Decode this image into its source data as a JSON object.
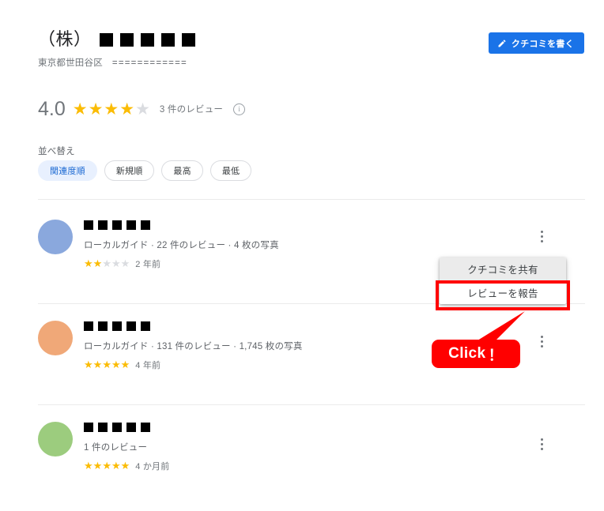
{
  "business": {
    "title_prefix": "（株）",
    "name_redacted_blocks": 5,
    "address": "東京都世田谷区",
    "address_masked": "============"
  },
  "write_review_button": {
    "label": "クチコミを書く",
    "icon": "pencil-icon",
    "color": "#1a73e8"
  },
  "rating_summary": {
    "value": "4.0",
    "stars_filled": 4,
    "stars_total": 5,
    "review_count_label": "3 件のレビュー",
    "info_icon": "info-icon",
    "star_color": "#fbbc04",
    "star_empty_color": "#dadce0"
  },
  "sort": {
    "label": "並べ替え",
    "chips": [
      {
        "label": "関連度順",
        "selected": true
      },
      {
        "label": "新規順",
        "selected": false
      },
      {
        "label": "最高",
        "selected": false
      },
      {
        "label": "最低",
        "selected": false
      }
    ],
    "selected_chip_bg": "#e8f0fe",
    "selected_chip_fg": "#1967d2"
  },
  "reviews": [
    {
      "avatar_color": "#8aa8dd",
      "name_redacted_blocks": 5,
      "meta": "ローカルガイド · 22 件のレビュー · 4 枚の写真",
      "stars_filled": 2,
      "stars_total": 5,
      "time": "2 年前"
    },
    {
      "avatar_color": "#f0a878",
      "name_redacted_blocks": 5,
      "meta": "ローカルガイド · 131 件のレビュー · 1,745 枚の写真",
      "stars_filled": 5,
      "stars_total": 5,
      "time": "4 年前"
    },
    {
      "avatar_color": "#9ccc7e",
      "name_redacted_blocks": 5,
      "meta": "1 件のレビュー",
      "stars_filled": 5,
      "stars_total": 5,
      "time": "4 か月前"
    }
  ],
  "context_menu": {
    "items": [
      {
        "label": "クチコミを共有",
        "highlighted": false
      },
      {
        "label": "レビューを報告",
        "highlighted": true
      }
    ],
    "hover_bg": "#ebebeb"
  },
  "annotation": {
    "label": "Click",
    "suffix": "！",
    "color": "#ff0000"
  },
  "glyphs": {
    "star": "★",
    "info": "i"
  }
}
